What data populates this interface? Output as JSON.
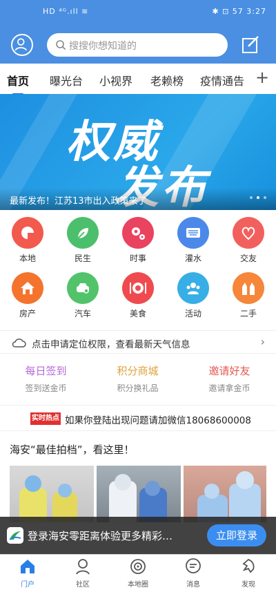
{
  "status": {
    "left": "HD ⁴ᴳ.ıll ≋",
    "right": "✱ ⊡ 57 3:27"
  },
  "header": {
    "search_placeholder": "搜搜你想知道的"
  },
  "tabs": [
    "首页",
    "曝光台",
    "小视界",
    "老赖榜",
    "疫情通告"
  ],
  "banner": {
    "title_line1": "权威",
    "title_line2": "发布",
    "caption": "最新发布！江苏13市出入政策来了"
  },
  "grid": [
    {
      "label": "本地",
      "color": "#f25a4e",
      "icon": "map-pin-icon"
    },
    {
      "label": "民生",
      "color": "#4cbf6d",
      "icon": "leaf-icon"
    },
    {
      "label": "时事",
      "color": "#e9435f",
      "icon": "gear-icon"
    },
    {
      "label": "灌水",
      "color": "#4b88ea",
      "icon": "keyboard-icon"
    },
    {
      "label": "交友",
      "color": "#f2605e",
      "icon": "heart-icon"
    },
    {
      "label": "房产",
      "color": "#f4742e",
      "icon": "house-icon"
    },
    {
      "label": "汽车",
      "color": "#52c36a",
      "icon": "car-icon"
    },
    {
      "label": "美食",
      "color": "#ef4a4f",
      "icon": "dish-icon"
    },
    {
      "label": "活动",
      "color": "#38aee6",
      "icon": "people-icon"
    },
    {
      "label": "二手",
      "color": "#f5863a",
      "icon": "hands-icon"
    }
  ],
  "weather": {
    "text": "点击申请定位权限，查看最新天气信息"
  },
  "promos": [
    {
      "title": "每日签到",
      "sub": "签到送金币",
      "color": "#b46ad8"
    },
    {
      "title": "积分商城",
      "sub": "积分换礼品",
      "color": "#e0a23c"
    },
    {
      "title": "邀请好友",
      "sub": "邀请拿金币",
      "color": "#e25a52"
    }
  ],
  "hot": {
    "tag": "实时热点",
    "text": "如果你登陆出现问题请加微信18068600008"
  },
  "section": {
    "title": "海安“最佳拍档”，看这里！"
  },
  "login": {
    "text": "登录海安零距离体验更多精彩…",
    "button": "立即登录"
  },
  "nav": [
    {
      "label": "门户",
      "icon": "home-icon"
    },
    {
      "label": "社区",
      "icon": "community-icon"
    },
    {
      "label": "本地圈",
      "icon": "local-circle-icon"
    },
    {
      "label": "消息",
      "icon": "message-icon"
    },
    {
      "label": "发现",
      "icon": "discover-icon"
    }
  ]
}
